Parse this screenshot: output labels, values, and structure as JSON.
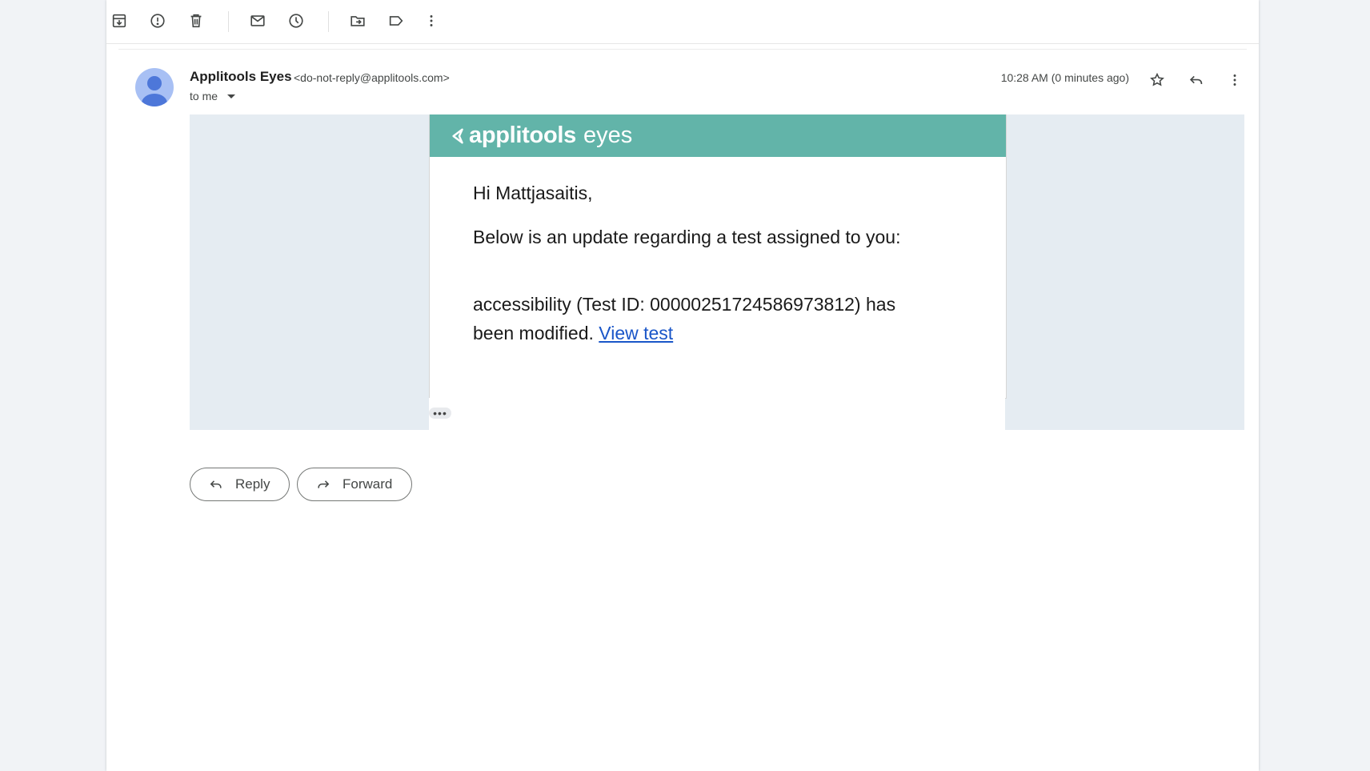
{
  "toolbar": {
    "icons": [
      "archive-icon",
      "report-spam-icon",
      "delete-icon",
      "mark-unread-icon",
      "snooze-icon",
      "move-to-icon",
      "label-icon",
      "more-vert-icon"
    ]
  },
  "message": {
    "sender_name": "Applitools Eyes",
    "sender_email": "<do-not-reply@applitools.com>",
    "recipient": "to me",
    "timestamp": "10:28 AM (0 minutes ago)"
  },
  "email_body": {
    "brand_name": "applitools",
    "brand_product": "eyes",
    "brand_color": "#62b4a9",
    "greeting": "Hi Mattjasaitis,",
    "intro": "Below is an update regarding a test assigned to you:",
    "update_line1": "accessibility (Test ID: 00000251724586973812) has",
    "update_line2": "been modified.",
    "link_text": "View test",
    "ellipsis": "•••"
  },
  "actions": {
    "reply_label": "Reply",
    "forward_label": "Forward"
  }
}
